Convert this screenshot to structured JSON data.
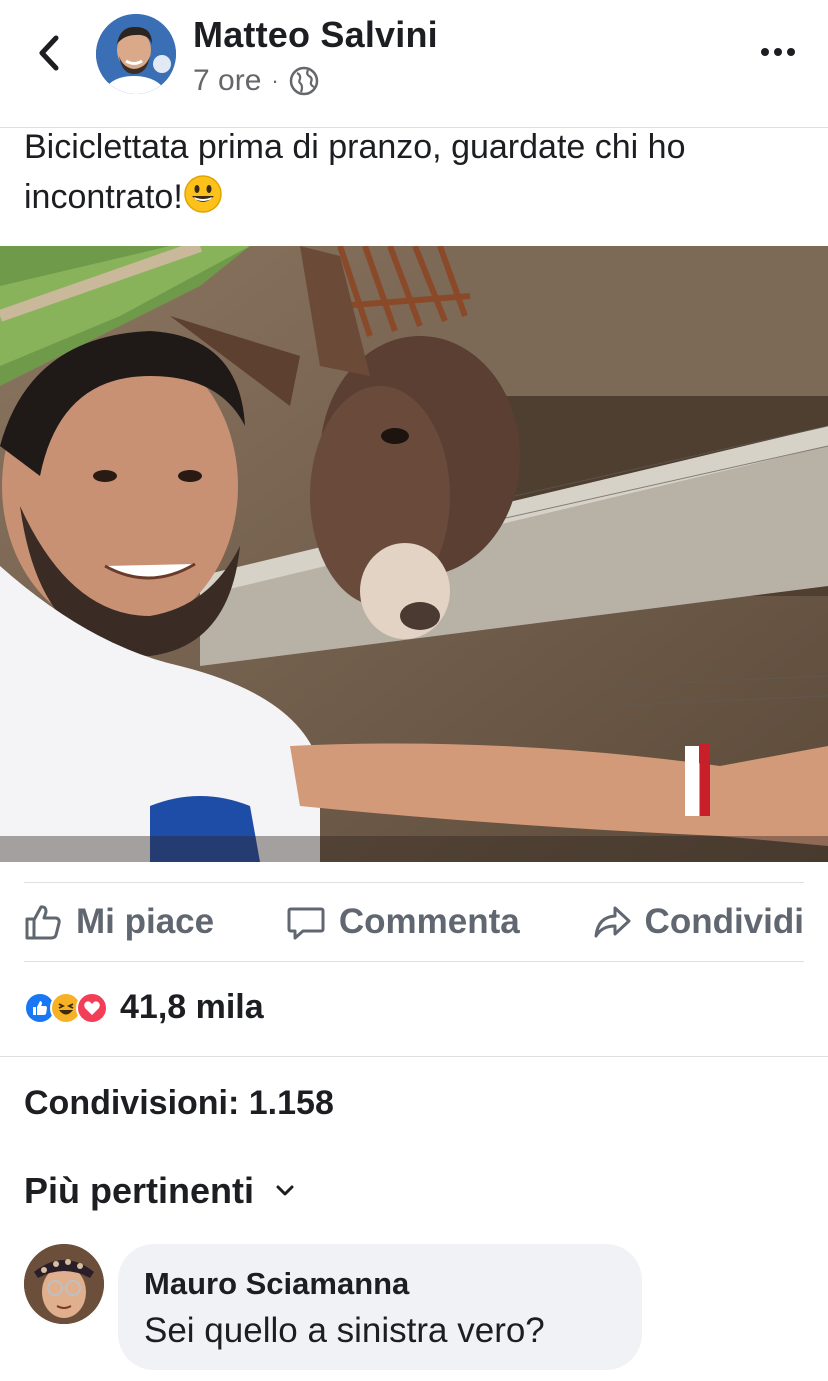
{
  "post": {
    "author": "Matteo Salvini",
    "time": "7 ore",
    "separator": "·",
    "privacy_icon": "globe-icon",
    "text": "Biciclettata prima di pranzo, guardate chi ho incontrato!",
    "text_emoji": "smiling-face-emoji",
    "photo_description_icon": "photo-selfie-with-donkey"
  },
  "actions": {
    "like_label": "Mi piace",
    "comment_label": "Commenta",
    "share_label": "Condividi"
  },
  "reactions": {
    "icons": [
      "like-reaction-icon",
      "haha-reaction-icon",
      "love-reaction-icon"
    ],
    "count": "41,8 mila"
  },
  "shares": {
    "label": "Condivisioni: 1.158"
  },
  "comments": {
    "sort_label": "Più pertinenti",
    "items": [
      {
        "author": "Mauro Sciamanna",
        "text": "Sei quello a sinistra vero?"
      }
    ]
  },
  "colors": {
    "text_primary": "#1c1e21",
    "text_secondary": "#65676b",
    "action_gray": "#606770",
    "like_blue": "#1877f2",
    "love_red": "#f33e58",
    "haha_yellow": "#f7b125",
    "bubble_bg": "#f0f2f5",
    "divider": "#dddfe2"
  }
}
